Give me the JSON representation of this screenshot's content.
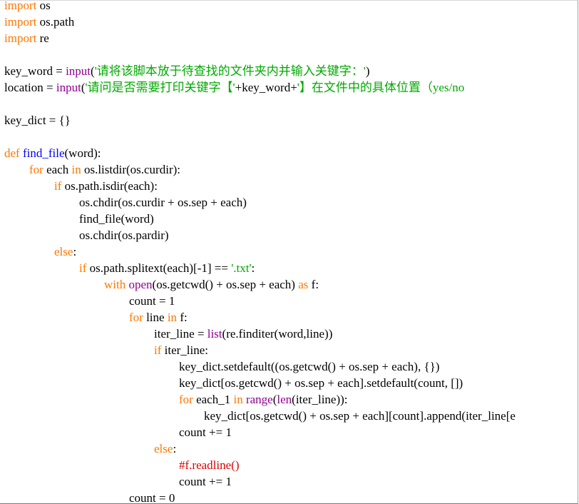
{
  "colors": {
    "keyword": "#ff7700",
    "builtin": "#900090",
    "definition": "#0000ff",
    "string": "#00aa00",
    "comment": "#dd0000",
    "default": "#000000",
    "background": "#ffffff"
  },
  "code_lines": [
    {
      "indent": 0,
      "tokens": [
        {
          "t": "import",
          "c": "kw"
        },
        {
          "t": " os",
          "c": "plain"
        }
      ]
    },
    {
      "indent": 0,
      "tokens": [
        {
          "t": "import",
          "c": "kw"
        },
        {
          "t": " os.path",
          "c": "plain"
        }
      ]
    },
    {
      "indent": 0,
      "tokens": [
        {
          "t": "import",
          "c": "kw"
        },
        {
          "t": " re",
          "c": "plain"
        }
      ]
    },
    {
      "indent": 0,
      "tokens": []
    },
    {
      "indent": 0,
      "tokens": [
        {
          "t": "key_word = ",
          "c": "plain"
        },
        {
          "t": "input",
          "c": "bi"
        },
        {
          "t": "(",
          "c": "plain"
        },
        {
          "t": "'请将该脚本放于待查找的文件夹内并输入关键字：'",
          "c": "str"
        },
        {
          "t": ")",
          "c": "plain"
        }
      ]
    },
    {
      "indent": 0,
      "tokens": [
        {
          "t": "location = ",
          "c": "plain"
        },
        {
          "t": "input",
          "c": "bi"
        },
        {
          "t": "(",
          "c": "plain"
        },
        {
          "t": "'请问是否需要打印关键字【'",
          "c": "str"
        },
        {
          "t": "+key_word+",
          "c": "plain"
        },
        {
          "t": "'】在文件中的具体位置（yes/no",
          "c": "str"
        }
      ]
    },
    {
      "indent": 0,
      "tokens": []
    },
    {
      "indent": 0,
      "tokens": [
        {
          "t": "key_dict = {}",
          "c": "plain"
        }
      ]
    },
    {
      "indent": 0,
      "tokens": []
    },
    {
      "indent": 0,
      "tokens": [
        {
          "t": "def",
          "c": "kw"
        },
        {
          "t": " ",
          "c": "plain"
        },
        {
          "t": "find_file",
          "c": "fn"
        },
        {
          "t": "(word):",
          "c": "plain"
        }
      ]
    },
    {
      "indent": 1,
      "tokens": [
        {
          "t": "for",
          "c": "kw"
        },
        {
          "t": " each ",
          "c": "plain"
        },
        {
          "t": "in",
          "c": "kw"
        },
        {
          "t": " os.listdir(os.curdir):",
          "c": "plain"
        }
      ]
    },
    {
      "indent": 2,
      "tokens": [
        {
          "t": "if",
          "c": "kw"
        },
        {
          "t": " os.path.isdir(each):",
          "c": "plain"
        }
      ]
    },
    {
      "indent": 3,
      "tokens": [
        {
          "t": "os.chdir(os.curdir + os.sep + each)",
          "c": "plain"
        }
      ]
    },
    {
      "indent": 3,
      "tokens": [
        {
          "t": "find_file(word)",
          "c": "plain"
        }
      ]
    },
    {
      "indent": 3,
      "tokens": [
        {
          "t": "os.chdir(os.pardir)",
          "c": "plain"
        }
      ]
    },
    {
      "indent": 2,
      "tokens": [
        {
          "t": "else",
          "c": "kw"
        },
        {
          "t": ":",
          "c": "plain"
        }
      ]
    },
    {
      "indent": 3,
      "tokens": [
        {
          "t": "if",
          "c": "kw"
        },
        {
          "t": " os.path.splitext(each)[-1] == ",
          "c": "plain"
        },
        {
          "t": "'.txt'",
          "c": "str"
        },
        {
          "t": ":",
          "c": "plain"
        }
      ]
    },
    {
      "indent": 4,
      "tokens": [
        {
          "t": "with",
          "c": "kw"
        },
        {
          "t": " ",
          "c": "plain"
        },
        {
          "t": "open",
          "c": "bi"
        },
        {
          "t": "(os.getcwd() + os.sep + each) ",
          "c": "plain"
        },
        {
          "t": "as",
          "c": "kw"
        },
        {
          "t": " f:",
          "c": "plain"
        }
      ]
    },
    {
      "indent": 5,
      "tokens": [
        {
          "t": "count = 1",
          "c": "plain"
        }
      ]
    },
    {
      "indent": 5,
      "tokens": [
        {
          "t": "for",
          "c": "kw"
        },
        {
          "t": " line ",
          "c": "plain"
        },
        {
          "t": "in",
          "c": "kw"
        },
        {
          "t": " f:",
          "c": "plain"
        }
      ]
    },
    {
      "indent": 6,
      "tokens": [
        {
          "t": "iter_line = ",
          "c": "plain"
        },
        {
          "t": "list",
          "c": "bi"
        },
        {
          "t": "(re.finditer(word,line))",
          "c": "plain"
        }
      ]
    },
    {
      "indent": 6,
      "tokens": [
        {
          "t": "if",
          "c": "kw"
        },
        {
          "t": " iter_line:",
          "c": "plain"
        }
      ]
    },
    {
      "indent": 7,
      "tokens": [
        {
          "t": "key_dict.setdefault((os.getcwd() + os.sep + each), {})",
          "c": "plain"
        }
      ]
    },
    {
      "indent": 7,
      "tokens": [
        {
          "t": "key_dict[os.getcwd() + os.sep + each].setdefault(count, [])",
          "c": "plain"
        }
      ]
    },
    {
      "indent": 7,
      "tokens": [
        {
          "t": "for",
          "c": "kw"
        },
        {
          "t": " each_1 ",
          "c": "plain"
        },
        {
          "t": "in",
          "c": "kw"
        },
        {
          "t": " ",
          "c": "plain"
        },
        {
          "t": "range",
          "c": "bi"
        },
        {
          "t": "(",
          "c": "plain"
        },
        {
          "t": "len",
          "c": "bi"
        },
        {
          "t": "(iter_line)):",
          "c": "plain"
        }
      ]
    },
    {
      "indent": 8,
      "tokens": [
        {
          "t": "key_dict[os.getcwd() + os.sep + each][count].append(iter_line[e",
          "c": "plain"
        }
      ]
    },
    {
      "indent": 7,
      "tokens": [
        {
          "t": "count += 1",
          "c": "plain"
        }
      ]
    },
    {
      "indent": 6,
      "tokens": [
        {
          "t": "else",
          "c": "kw"
        },
        {
          "t": ":",
          "c": "plain"
        }
      ]
    },
    {
      "indent": 7,
      "tokens": [
        {
          "t": "#f.readline()",
          "c": "cm"
        }
      ]
    },
    {
      "indent": 7,
      "tokens": [
        {
          "t": "count += 1",
          "c": "plain"
        }
      ]
    },
    {
      "indent": 5,
      "tokens": [
        {
          "t": "count = 0",
          "c": "plain"
        }
      ]
    }
  ]
}
